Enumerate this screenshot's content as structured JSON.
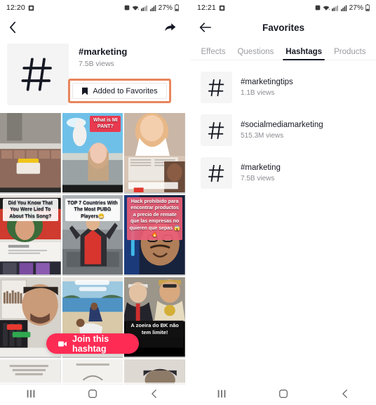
{
  "left_screen": {
    "status_bar": {
      "time": "12:20",
      "battery_percent": "27%",
      "icons": [
        "alarm-icon",
        "wifi-icon",
        "network-icon",
        "signal-icon",
        "battery-icon"
      ]
    },
    "appbar": {
      "back_icon": "chevron-left-icon",
      "share_icon": "share-arrow-icon"
    },
    "hashtag": {
      "avatar_glyph": "#",
      "name": "#marketing",
      "views": "7.5B views",
      "favorite_button": {
        "label": "Added to Favorites",
        "icon": "bookmark-filled-icon",
        "highlight_color": "#e8855c"
      }
    },
    "join_button": {
      "label": "Join this hashtag",
      "icon": "video-camera-icon",
      "color": "#fe2c55"
    },
    "grid": {
      "tiles": [
        {
          "caption": "",
          "caption_color": ""
        },
        {
          "caption": "What is\nMI PANT?",
          "caption_color": "#e8394f"
        },
        {
          "caption": "",
          "caption_color": ""
        },
        {
          "caption": "Did You Know That You Were Lied To About This Song?",
          "caption_color": "#1c1c1c"
        },
        {
          "caption": "TOP 7 Countries With The Most PUBG Players😁",
          "caption_color": "#1c1c1c"
        },
        {
          "caption": "Hack prohibido para encontrar productos a precio de remate que las empresas no quieren que sepas 😱🔥",
          "caption_color": "#f2697e"
        },
        {
          "caption": "",
          "caption_color": ""
        },
        {
          "caption": "",
          "caption_color": ""
        },
        {
          "caption": "A zoeira do BK não tem limite!",
          "caption_color": "#111111"
        }
      ]
    },
    "nav_bar": {
      "recents_icon": "recents-icon",
      "home_icon": "home-circle-icon",
      "back_icon": "back-chevron-icon"
    }
  },
  "right_screen": {
    "status_bar": {
      "time": "12:21",
      "battery_percent": "27%",
      "icons": [
        "alarm-icon",
        "wifi-icon",
        "network-icon",
        "signal-icon",
        "battery-icon"
      ]
    },
    "appbar": {
      "back_icon": "arrow-left-icon",
      "title": "Favorites"
    },
    "tabs": [
      {
        "label": "Effects",
        "active": false
      },
      {
        "label": "Questions",
        "active": false
      },
      {
        "label": "Hashtags",
        "active": true
      },
      {
        "label": "Products",
        "active": false
      }
    ],
    "hashtags": [
      {
        "avatar_glyph": "#",
        "name": "#marketingtips",
        "views": "1.1B views"
      },
      {
        "avatar_glyph": "#",
        "name": "#socialmediamarketing",
        "views": "515.3M views"
      },
      {
        "avatar_glyph": "#",
        "name": "#marketing",
        "views": "7.5B views"
      }
    ],
    "nav_bar": {
      "recents_icon": "recents-icon",
      "home_icon": "home-circle-icon",
      "back_icon": "back-chevron-icon"
    }
  }
}
